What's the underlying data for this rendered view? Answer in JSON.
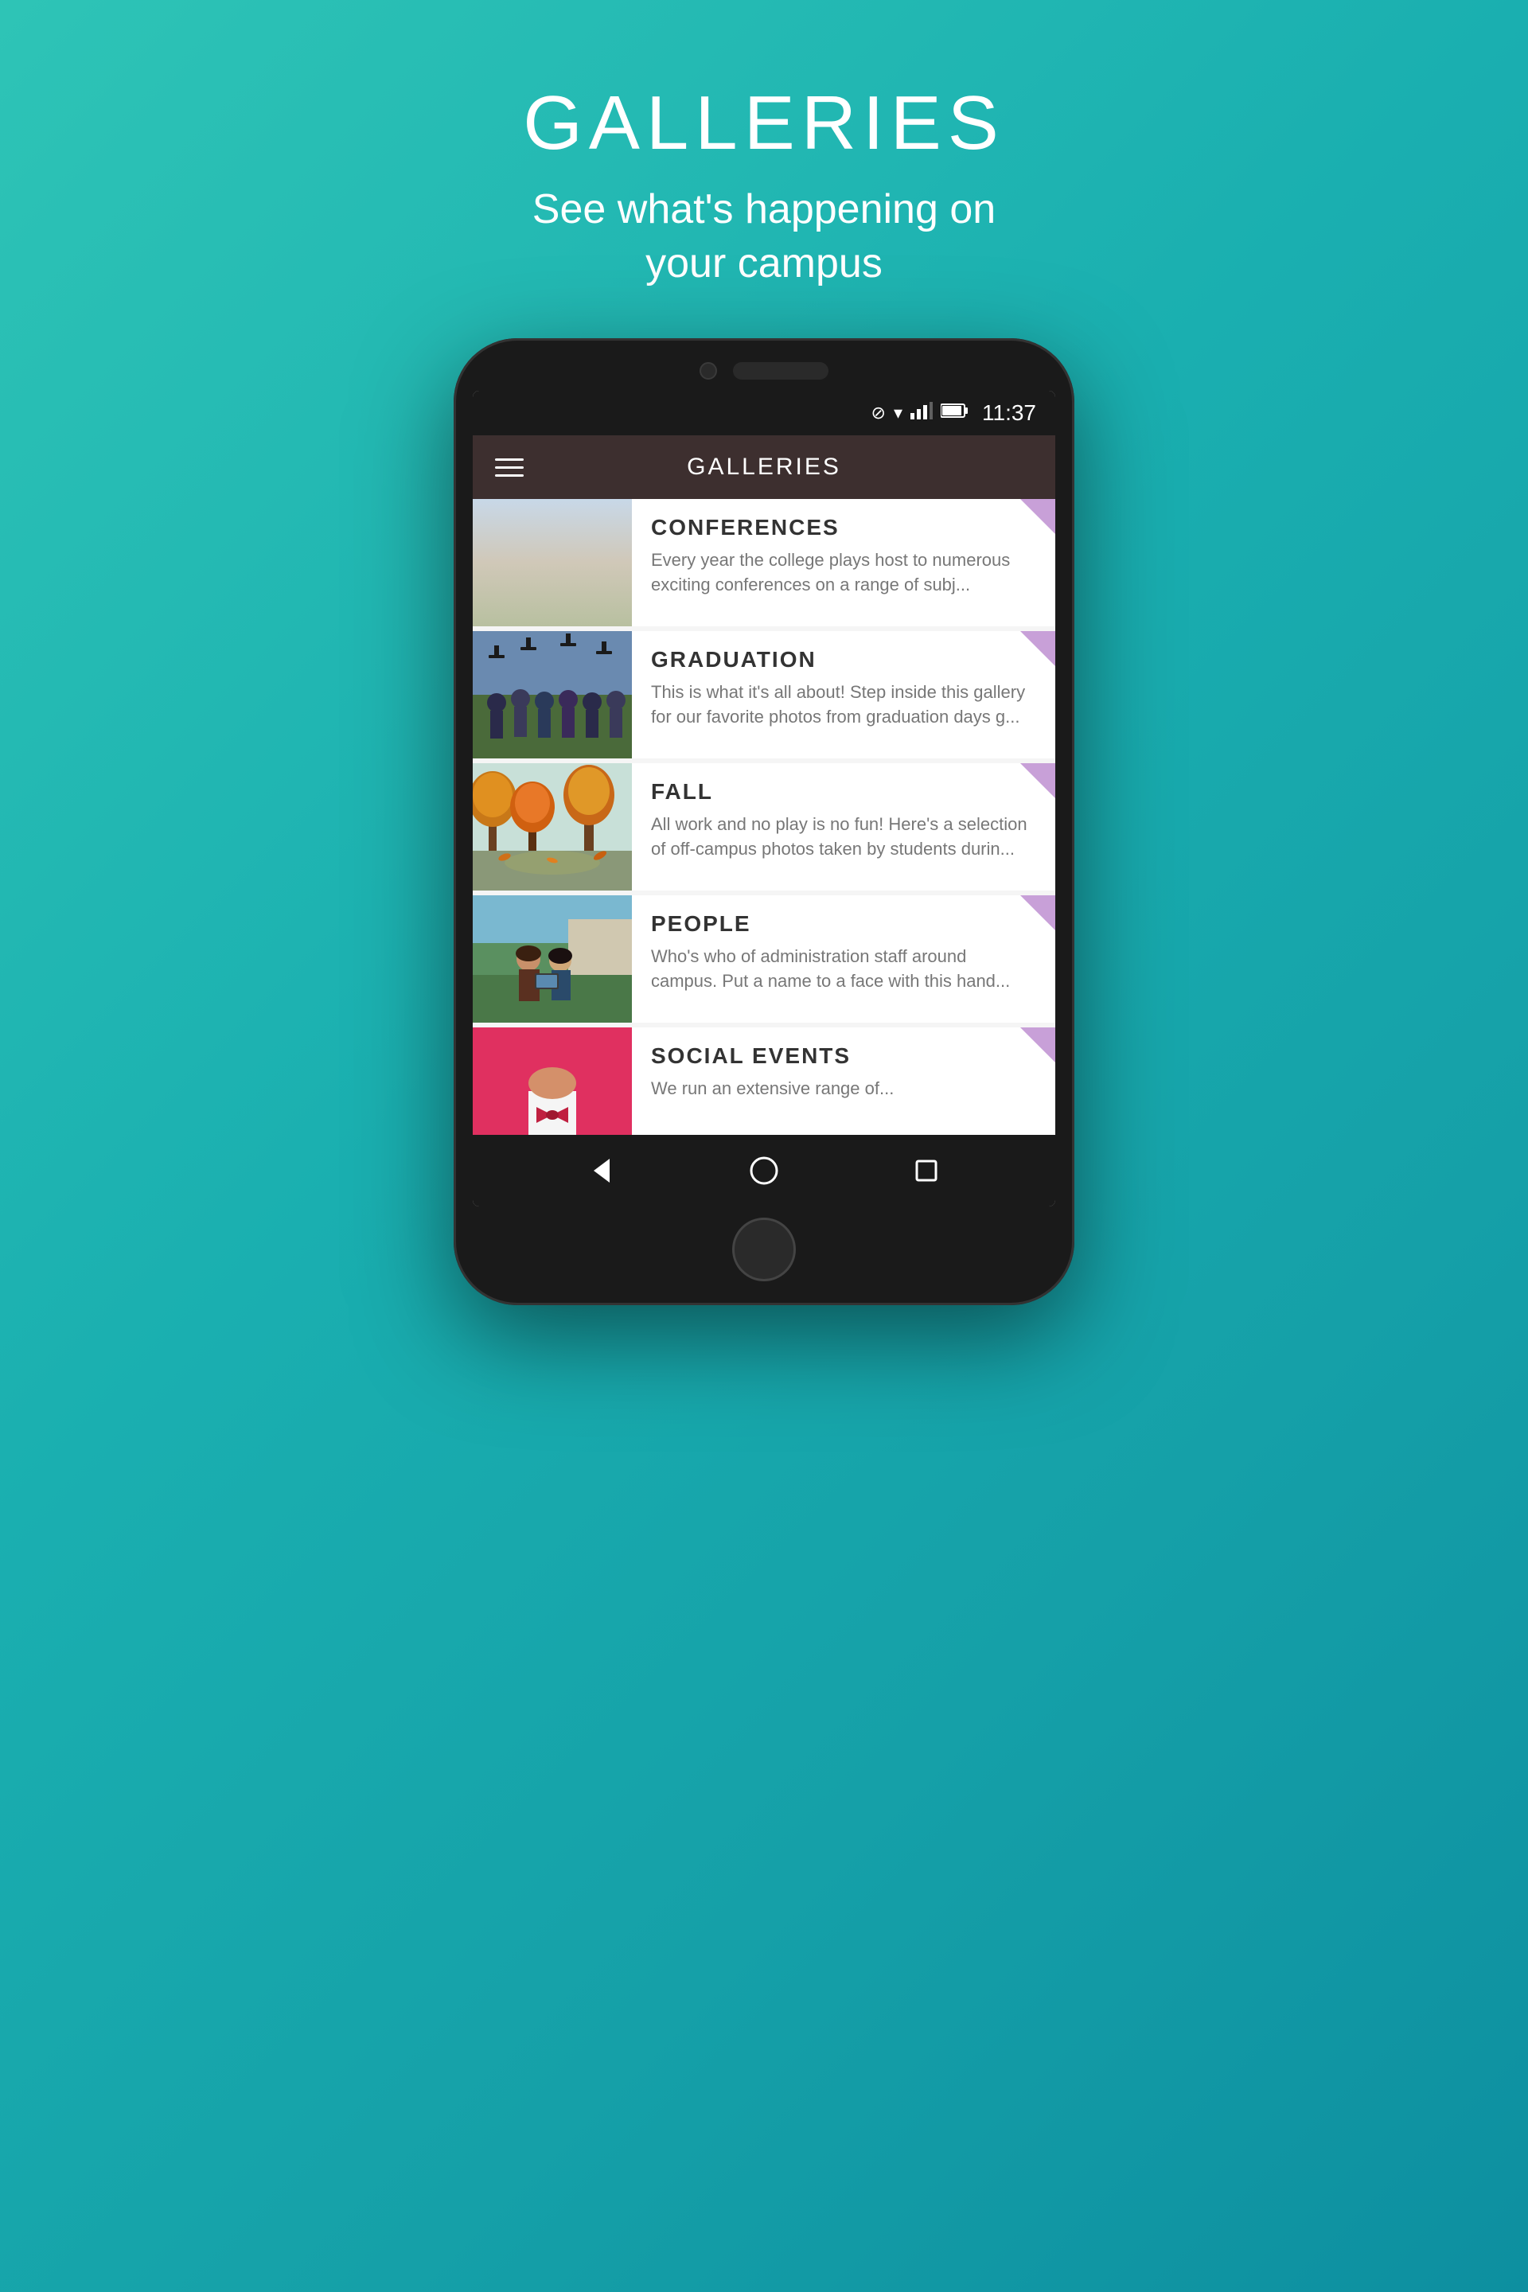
{
  "page": {
    "title": "GALLERIES",
    "subtitle": "See what's happening on\nyour campus",
    "background_color": "#2ec4b6"
  },
  "appbar": {
    "title": "GALLERIES"
  },
  "statusbar": {
    "time": "11:37"
  },
  "gallery_items": [
    {
      "id": "conferences",
      "title": "CONFERENCES",
      "description": "Every year the college plays host to numerous exciting conferences on a range of subj..."
    },
    {
      "id": "graduation",
      "title": "GRADUATION",
      "description": "This is what it's all about!  Step inside this gallery for our favorite photos from graduation days g..."
    },
    {
      "id": "fall",
      "title": "FALL",
      "description": "All work and no play is no fun!  Here's a selection of off-campus photos taken by students durin..."
    },
    {
      "id": "people",
      "title": "PEOPLE",
      "description": "Who's who of administration staff around campus.  Put a name to a face with this hand..."
    },
    {
      "id": "social-events",
      "title": "SOCIAL EVENTS",
      "description": "We run an extensive range of..."
    }
  ]
}
